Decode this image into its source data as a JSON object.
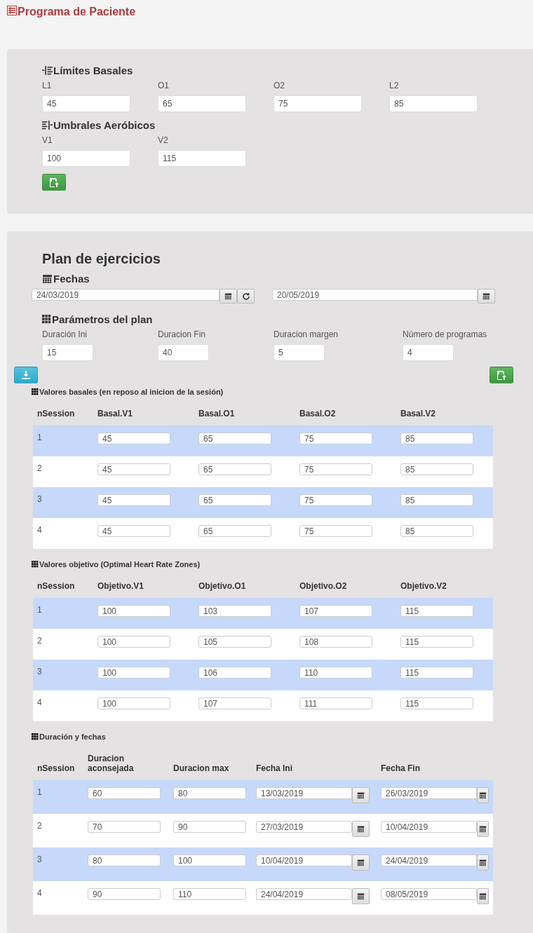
{
  "header": {
    "title": "Programa de Paciente"
  },
  "limits": {
    "groups": [
      {
        "title": "Límites Basales",
        "fields": [
          {
            "label": "L1",
            "value": "45"
          },
          {
            "label": "O1",
            "value": "65"
          },
          {
            "label": "O2",
            "value": "75"
          },
          {
            "label": "L2",
            "value": "85"
          }
        ]
      },
      {
        "title": "Umbrales Aeróbicos",
        "fields": [
          {
            "label": "V1",
            "value": "100"
          },
          {
            "label": "V2",
            "value": "115"
          }
        ]
      }
    ]
  },
  "plan": {
    "title": "Plan de ejercicios",
    "dates": {
      "title": "Fechas",
      "start": "24/03/2019",
      "end": "20/05/2019"
    },
    "params": {
      "title": "Parámetros del plan",
      "fields": [
        {
          "label": "Duración Ini",
          "value": "15"
        },
        {
          "label": "Duracion Fin",
          "value": "40"
        },
        {
          "label": "Duracion margen",
          "value": "5"
        },
        {
          "label": "Número de programas",
          "value": "4"
        }
      ]
    },
    "tables": [
      {
        "title": "Valores basales (en reposo al inicion de la sesión)",
        "columns": [
          {
            "label": "nSession",
            "kind": "text"
          },
          {
            "label": "Basal.V1",
            "kind": "field"
          },
          {
            "label": "Basal.O1",
            "kind": "field"
          },
          {
            "label": "Basal.O2",
            "kind": "field"
          },
          {
            "label": "Basal.V2",
            "kind": "field"
          }
        ],
        "rows": [
          [
            "1",
            "45",
            "65",
            "75",
            "85"
          ],
          [
            "2",
            "45",
            "65",
            "75",
            "85"
          ],
          [
            "3",
            "45",
            "65",
            "75",
            "85"
          ],
          [
            "4",
            "45",
            "65",
            "75",
            "85"
          ]
        ]
      },
      {
        "title": "Valores objetivo (Optimal Heart Rate Zones)",
        "columns": [
          {
            "label": "nSession",
            "kind": "text"
          },
          {
            "label": "Objetivo.V1",
            "kind": "field"
          },
          {
            "label": "Objetivo.O1",
            "kind": "field"
          },
          {
            "label": "Objetivo.O2",
            "kind": "field"
          },
          {
            "label": "Objetivo.V2",
            "kind": "field"
          }
        ],
        "rows": [
          [
            "1",
            "100",
            "103",
            "107",
            "115"
          ],
          [
            "2",
            "100",
            "105",
            "108",
            "115"
          ],
          [
            "3",
            "100",
            "106",
            "110",
            "115"
          ],
          [
            "4",
            "100",
            "107",
            "111",
            "115"
          ]
        ]
      },
      {
        "title": "Duración y fechas",
        "columns": [
          {
            "label": "nSession",
            "kind": "text"
          },
          {
            "label": "Duracion aconsejada",
            "kind": "field"
          },
          {
            "label": "Duracion max",
            "kind": "field"
          },
          {
            "label": "Fecha Ini",
            "kind": "date"
          },
          {
            "label": "Fecha Fin",
            "kind": "date"
          }
        ],
        "rows": [
          [
            "1",
            "60",
            "80",
            "13/03/2019",
            "26/03/2019"
          ],
          [
            "2",
            "70",
            "90",
            "27/03/2019",
            "10/04/2019"
          ],
          [
            "3",
            "80",
            "100",
            "10/04/2019",
            "24/04/2019"
          ],
          [
            "4",
            "90",
            "110",
            "24/04/2019",
            "08/05/2019"
          ]
        ]
      }
    ]
  }
}
